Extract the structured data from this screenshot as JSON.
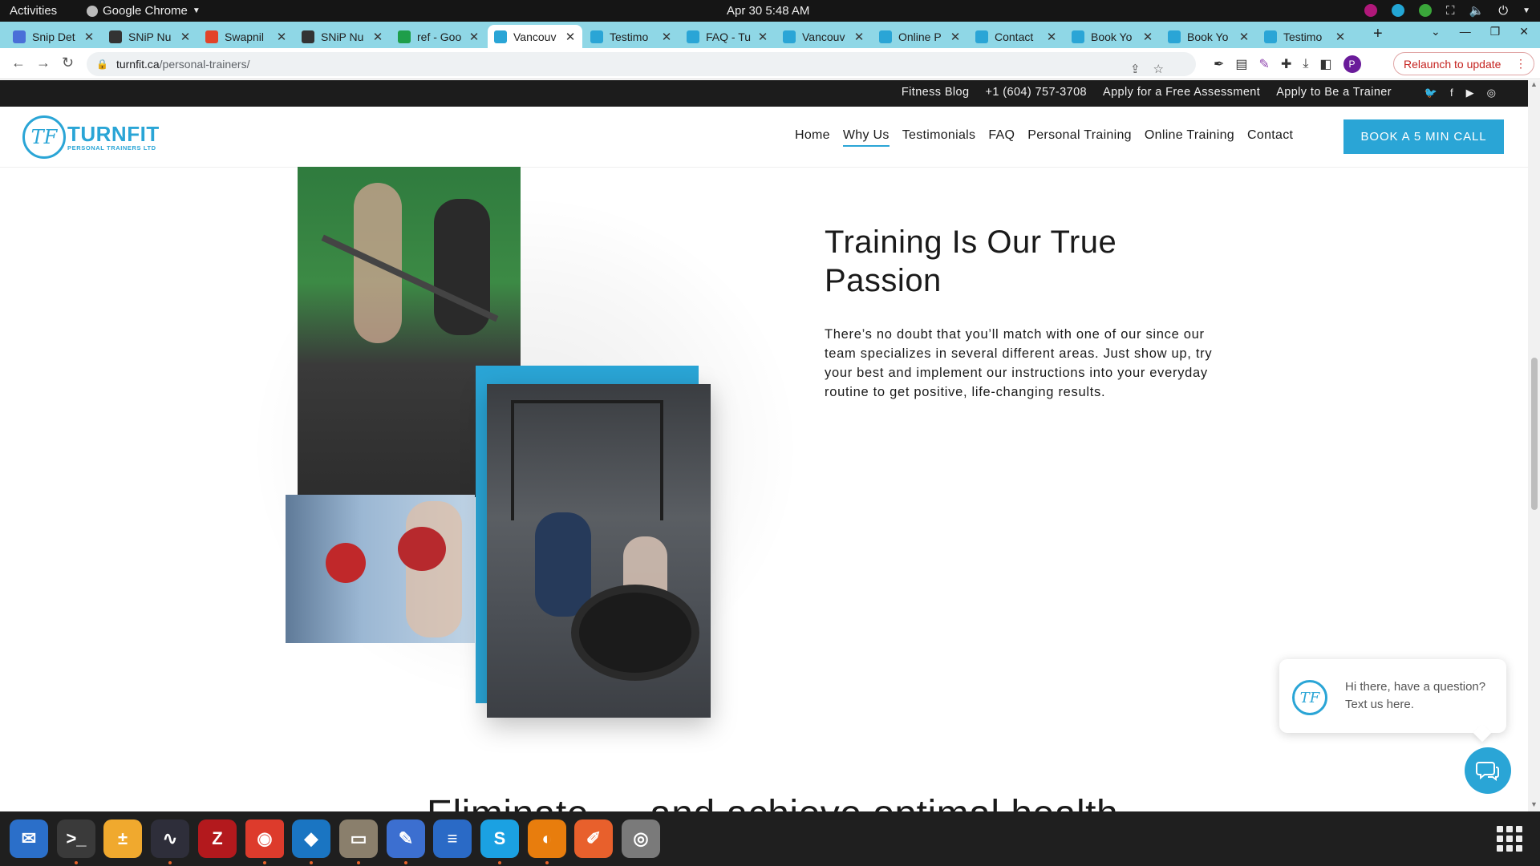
{
  "gnome": {
    "activities": "Activities",
    "app_name": "Google Chrome",
    "clock": "Apr 30  5:48 AM"
  },
  "tabs": [
    {
      "title": "Snip Det",
      "favicon_color": "#4a6fd8",
      "active": false
    },
    {
      "title": "SNiP Nu",
      "favicon_color": "#333333",
      "active": false
    },
    {
      "title": "Swapnil",
      "favicon_color": "#e24329",
      "active": false
    },
    {
      "title": "SNiP Nu",
      "favicon_color": "#333333",
      "active": false
    },
    {
      "title": "ref - Goo",
      "favicon_color": "#1e9e4a",
      "active": false
    },
    {
      "title": "Vancouv",
      "favicon_color": "#2aa5d6",
      "active": true
    },
    {
      "title": "Testimo",
      "favicon_color": "#2aa5d6",
      "active": false
    },
    {
      "title": "FAQ - Tu",
      "favicon_color": "#2aa5d6",
      "active": false
    },
    {
      "title": "Vancouv",
      "favicon_color": "#2aa5d6",
      "active": false
    },
    {
      "title": "Online P",
      "favicon_color": "#2aa5d6",
      "active": false
    },
    {
      "title": "Contact",
      "favicon_color": "#2aa5d6",
      "active": false
    },
    {
      "title": "Book Yo",
      "favicon_color": "#2aa5d6",
      "active": false
    },
    {
      "title": "Book Yo",
      "favicon_color": "#2aa5d6",
      "active": false
    },
    {
      "title": "Testimo",
      "favicon_color": "#2aa5d6",
      "active": false
    }
  ],
  "toolbar": {
    "url_domain": "turnfit.ca",
    "url_path": "/personal-trainers/",
    "profile_initial": "P",
    "relaunch_label": "Relaunch to update"
  },
  "site": {
    "topbar_links": [
      "Fitness Blog",
      "+1 (604) 757-3708",
      "Apply for a Free Assessment",
      "Apply to Be a Trainer"
    ],
    "social_icons": [
      "twitter-icon",
      "facebook-icon",
      "youtube-icon",
      "instagram-icon"
    ],
    "logo_monogram": "TF",
    "logo_word": "TURNFIT",
    "logo_sub": "PERSONAL TRAINERS LTD",
    "nav": [
      {
        "label": "Home",
        "active": false
      },
      {
        "label": "Why Us",
        "active": true
      },
      {
        "label": "Testimonials",
        "active": false
      },
      {
        "label": "FAQ",
        "active": false
      },
      {
        "label": "Personal Training",
        "active": false
      },
      {
        "label": "Online Training",
        "active": false
      },
      {
        "label": "Contact",
        "active": false
      }
    ],
    "cta": "BOOK A 5 MIN CALL",
    "brand_color": "#2aa5d6"
  },
  "section": {
    "heading": "Training Is Our True Passion",
    "body": "There’s no doubt that you’ll match with one of our since our team specializes in several different areas. Just show up, try your best and implement our instructions into your everyday routine to get positive, life-changing results.",
    "next_heading_partial": "Eliminate   …   and achieve optimal health"
  },
  "chat": {
    "monogram": "TF",
    "message": "Hi there, have a question? Text us here."
  },
  "dock": [
    {
      "name": "thunderbird",
      "color": "#2b6fc9",
      "glyph": "✉",
      "dot": false
    },
    {
      "name": "terminal",
      "color": "#3a3a3a",
      "glyph": ">_",
      "dot": true
    },
    {
      "name": "calculator",
      "color": "#f0a92e",
      "glyph": "±",
      "dot": false
    },
    {
      "name": "system-monitor",
      "color": "#2e2e3a",
      "glyph": "∿",
      "dot": true
    },
    {
      "name": "filezilla",
      "color": "#b3191d",
      "glyph": "Z",
      "dot": false
    },
    {
      "name": "chrome",
      "color": "#dd3b2c",
      "glyph": "◉",
      "dot": true
    },
    {
      "name": "vscode",
      "color": "#1a75c2",
      "glyph": "◆",
      "dot": true
    },
    {
      "name": "files",
      "color": "#8a7f6c",
      "glyph": "▭",
      "dot": true
    },
    {
      "name": "text-editor",
      "color": "#3c6fd0",
      "glyph": "✎",
      "dot": true
    },
    {
      "name": "libreoffice-writer",
      "color": "#2a6ac6",
      "glyph": "≡",
      "dot": false
    },
    {
      "name": "skype",
      "color": "#1ba1e2",
      "glyph": "S",
      "dot": true
    },
    {
      "name": "blender",
      "color": "#e87d0d",
      "glyph": "◐",
      "dot": true
    },
    {
      "name": "drawing",
      "color": "#e8602c",
      "glyph": "✐",
      "dot": false
    },
    {
      "name": "disks",
      "color": "#7a7a7a",
      "glyph": "◎",
      "dot": false
    }
  ]
}
